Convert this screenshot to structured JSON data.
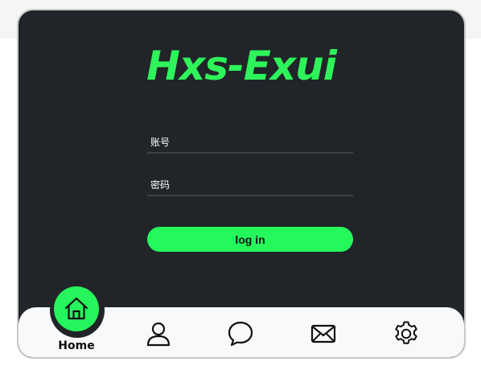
{
  "app": {
    "title": "Hxs-Exui"
  },
  "form": {
    "account_placeholder": "账号",
    "password_placeholder": "密码",
    "login_label": "log in"
  },
  "nav": {
    "active": "home",
    "items": [
      {
        "id": "home",
        "label": "Home",
        "icon": "home-icon"
      },
      {
        "id": "profile",
        "label": "",
        "icon": "user-icon"
      },
      {
        "id": "messages",
        "label": "",
        "icon": "chat-bubble-icon"
      },
      {
        "id": "mail",
        "label": "",
        "icon": "mail-icon"
      },
      {
        "id": "settings",
        "label": "",
        "icon": "gear-icon"
      }
    ]
  },
  "colors": {
    "accent": "#26f55d",
    "card_bg": "#212428",
    "nav_bg": "#f8f9fa"
  }
}
